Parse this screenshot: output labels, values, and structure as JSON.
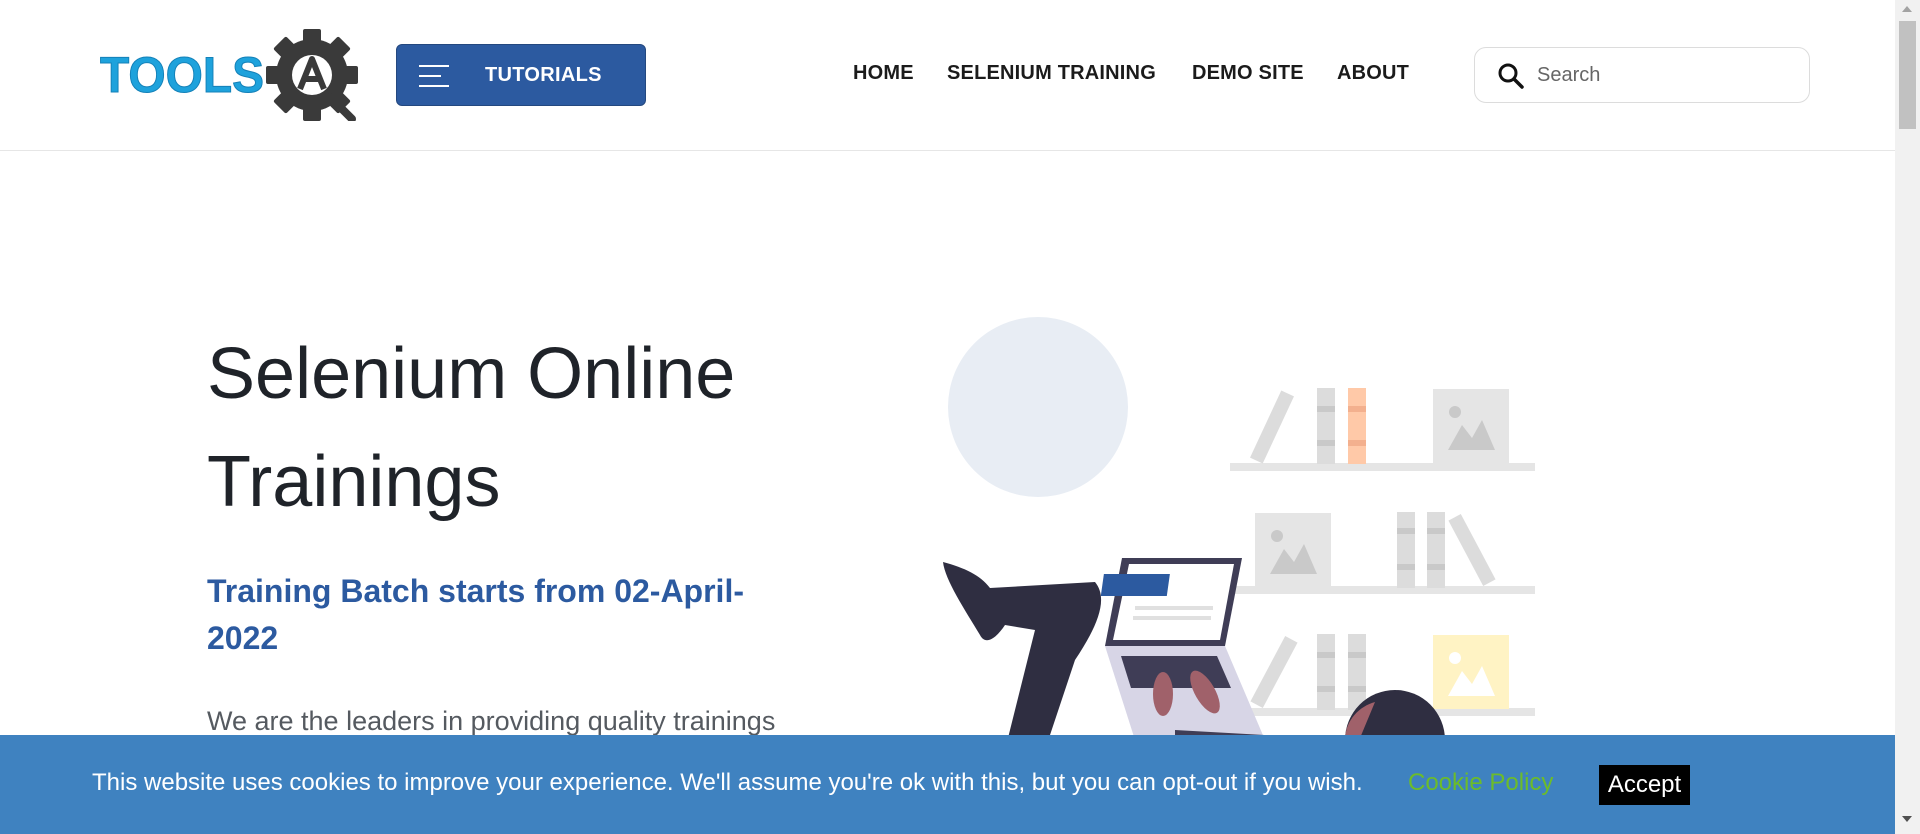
{
  "header": {
    "logo_text": "TOOLSQA",
    "tutorials_label": "TUTORIALS",
    "nav": [
      {
        "label": "HOME"
      },
      {
        "label": "SELENIUM TRAINING"
      },
      {
        "label": "DEMO SITE"
      },
      {
        "label": "ABOUT"
      }
    ],
    "search": {
      "placeholder": "Search",
      "value": "",
      "icon": "search-icon"
    }
  },
  "hero": {
    "title": "Selenium Online Trainings",
    "subtitle": "Training Batch starts from 02-April-2022",
    "text": "We are the leaders in providing quality trainings"
  },
  "cookie_bar": {
    "message": "This website uses cookies to improve your experience. We'll assume you're ok with this, but you can opt-out if you wish.",
    "policy_link": "Cookie Policy",
    "accept_label": "Accept"
  },
  "colors": {
    "brand_blue": "#2c5aa0",
    "logo_cyan": "#1ea2dc",
    "cookie_bar": "#3f82c0",
    "cookie_link": "#6cbc2a",
    "accent_orange": "#ffc9a8"
  }
}
